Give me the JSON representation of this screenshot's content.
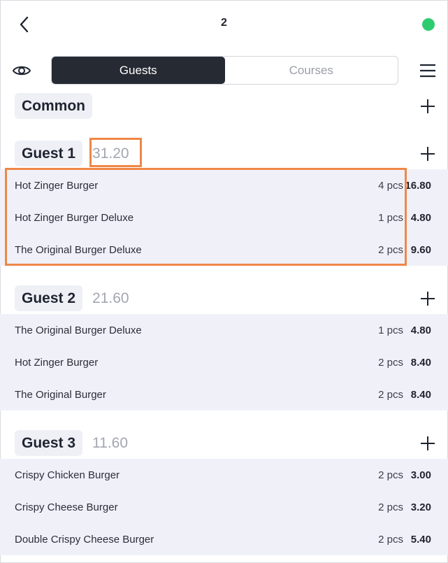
{
  "header": {
    "title": "2",
    "status_color": "#2ecc71"
  },
  "tabs": [
    {
      "label": "Guests"
    },
    {
      "label": "Courses"
    }
  ],
  "groups": [
    {
      "label": "Common"
    },
    {
      "label": "Guest 1",
      "total": "31.20",
      "items": [
        {
          "name": "Hot Zinger Burger",
          "qty": "4 pcs",
          "price": "16.80"
        },
        {
          "name": "Hot Zinger Burger Deluxe",
          "qty": "1 pcs",
          "price": "4.80"
        },
        {
          "name": "The Original Burger Deluxe",
          "qty": "2 pcs",
          "price": "9.60"
        }
      ]
    },
    {
      "label": "Guest 2",
      "total": "21.60",
      "items": [
        {
          "name": "The Original Burger Deluxe",
          "qty": "1 pcs",
          "price": "4.80"
        },
        {
          "name": "Hot Zinger Burger",
          "qty": "2 pcs",
          "price": "8.40"
        },
        {
          "name": "The Original Burger",
          "qty": "2 pcs",
          "price": "8.40"
        }
      ]
    },
    {
      "label": "Guest 3",
      "total": "11.60",
      "items": [
        {
          "name": "Crispy Chicken Burger",
          "qty": "2 pcs",
          "price": "3.00"
        },
        {
          "name": "Crispy Cheese Burger",
          "qty": "2 pcs",
          "price": "3.20"
        },
        {
          "name": "Double Crispy Cheese Burger",
          "qty": "2 pcs",
          "price": "5.40"
        }
      ]
    }
  ],
  "colors": {
    "highlight": "#ef8747",
    "row_background": "#f0f1f8",
    "active_tab": "#262a33"
  }
}
